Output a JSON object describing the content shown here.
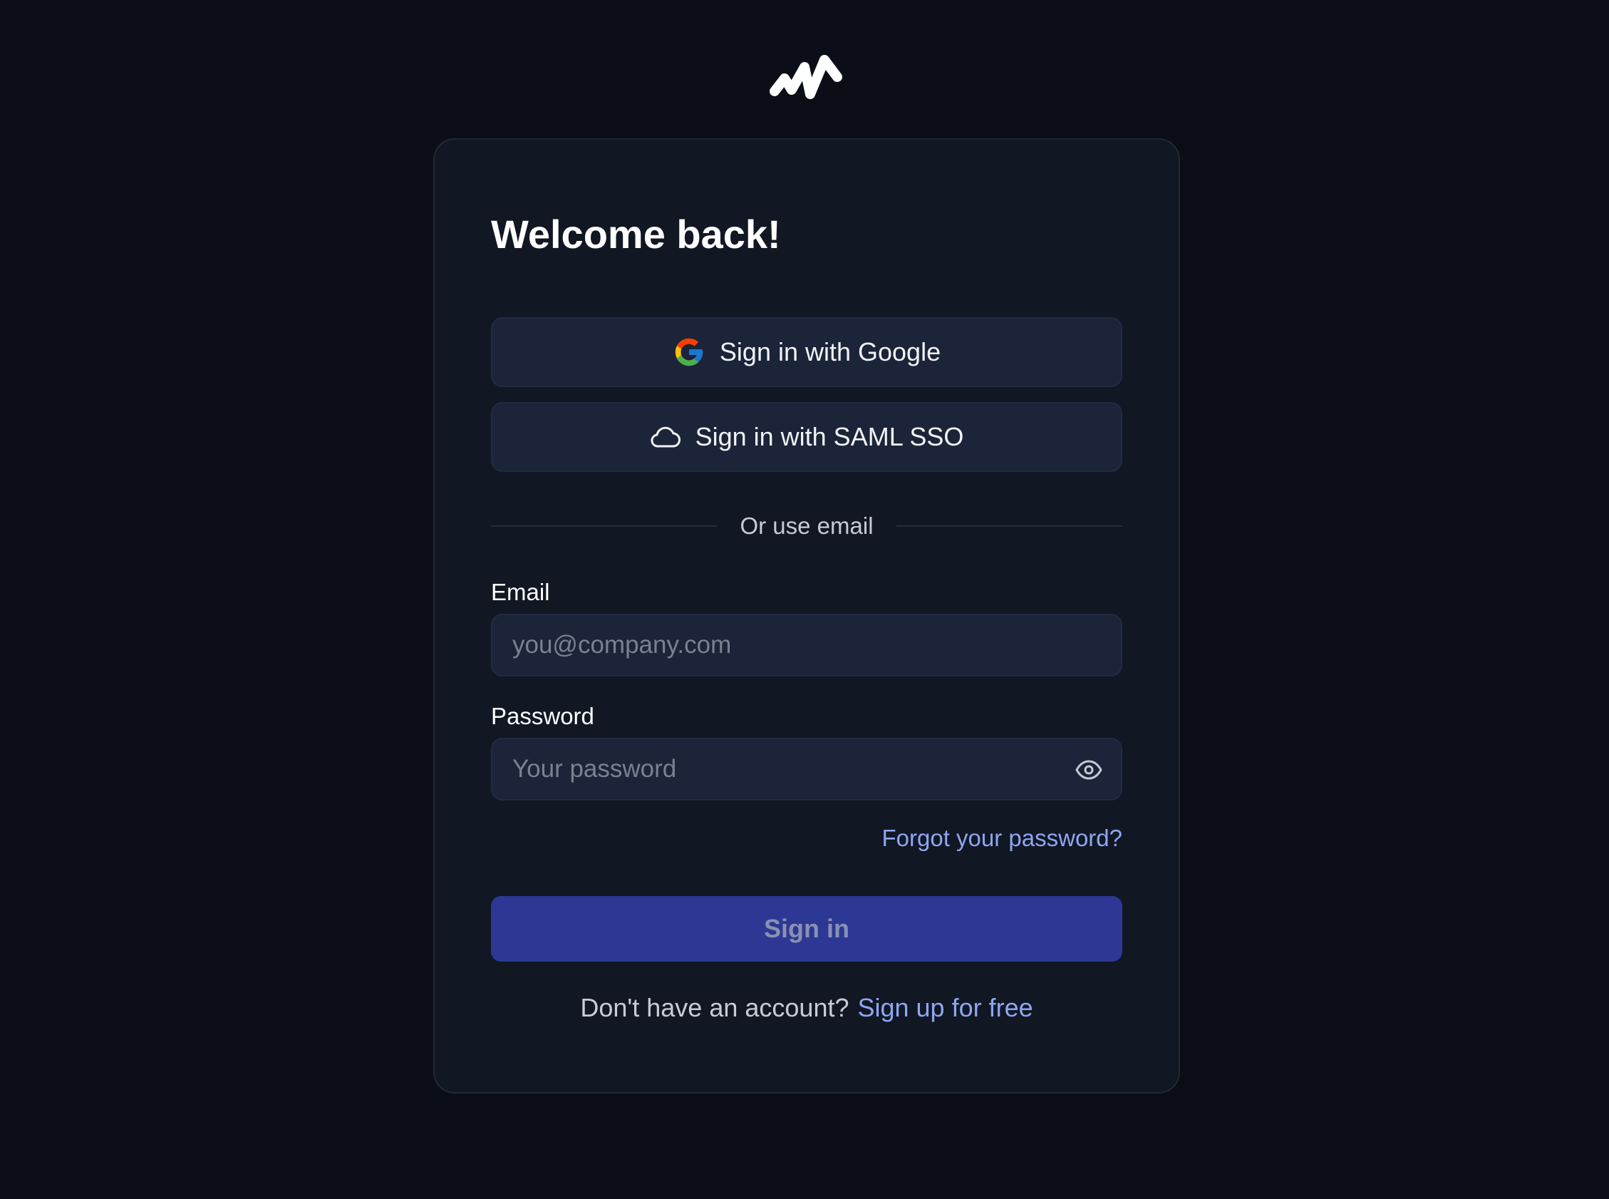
{
  "brand": {
    "logo_icon": "zigzag-wave-logo",
    "colors": {
      "background": "#0b0e16",
      "card": "#111723",
      "button": "#1b2438",
      "primary": "#2c3893",
      "link": "#8ea6f2"
    }
  },
  "login": {
    "title": "Welcome back!",
    "google_button": {
      "label": "Sign in with Google",
      "icon": "google-icon"
    },
    "saml_button": {
      "label": "Sign in with SAML SSO",
      "icon": "cloud-icon"
    },
    "divider_text": "Or use email",
    "email": {
      "label": "Email",
      "placeholder": "you@company.com",
      "value": ""
    },
    "password": {
      "label": "Password",
      "placeholder": "Your password",
      "value": "",
      "toggle_icon": "eye-icon"
    },
    "forgot_password": "Forgot your password?",
    "submit_label": "Sign in",
    "signup_prompt": "Don't have an account?",
    "signup_link": "Sign up for free"
  }
}
